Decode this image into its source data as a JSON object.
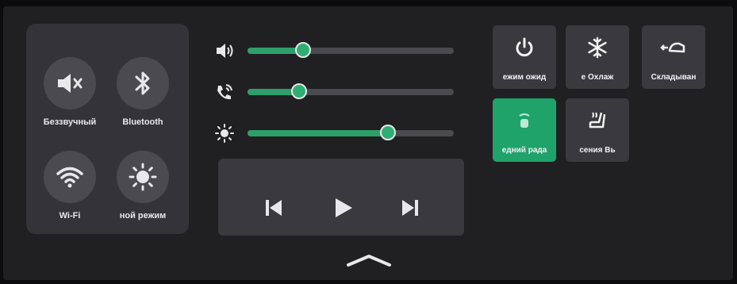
{
  "colors": {
    "accent": "#2fae74",
    "panel": "#343438",
    "tile": "#3a3a3e",
    "active_tile": "#20a36b"
  },
  "quick_toggles": [
    {
      "label": "Беззвучный",
      "icon": "speaker-mute-icon"
    },
    {
      "label": "Bluetooth",
      "icon": "bluetooth-icon"
    },
    {
      "label": "Wi-Fi",
      "icon": "wifi-icon"
    },
    {
      "label": "ной режим",
      "icon": "sun-icon"
    }
  ],
  "sliders": [
    {
      "name": "media-volume",
      "icon": "volume-icon",
      "level": 0.27
    },
    {
      "name": "call-volume",
      "icon": "phone-icon",
      "level": 0.25
    },
    {
      "name": "brightness",
      "icon": "brightness-icon",
      "level": 0.68
    }
  ],
  "media": {
    "prev_icon": "skip-previous-icon",
    "play_icon": "play-icon",
    "next_icon": "skip-next-icon"
  },
  "tiles": [
    {
      "label": "ежим ожид",
      "icon": "power-icon",
      "active": false
    },
    {
      "label": "е    Охлаж",
      "icon": "snowflake-icon",
      "active": false
    },
    {
      "label": "Складыван",
      "icon": "mirror-fold-icon",
      "active": false
    },
    {
      "label": "едний рада",
      "icon": "front-radar-icon",
      "active": true
    },
    {
      "label": "сения     Вь",
      "icon": "seat-heat-icon",
      "active": false
    }
  ],
  "collapse_icon": "chevron-up-icon"
}
